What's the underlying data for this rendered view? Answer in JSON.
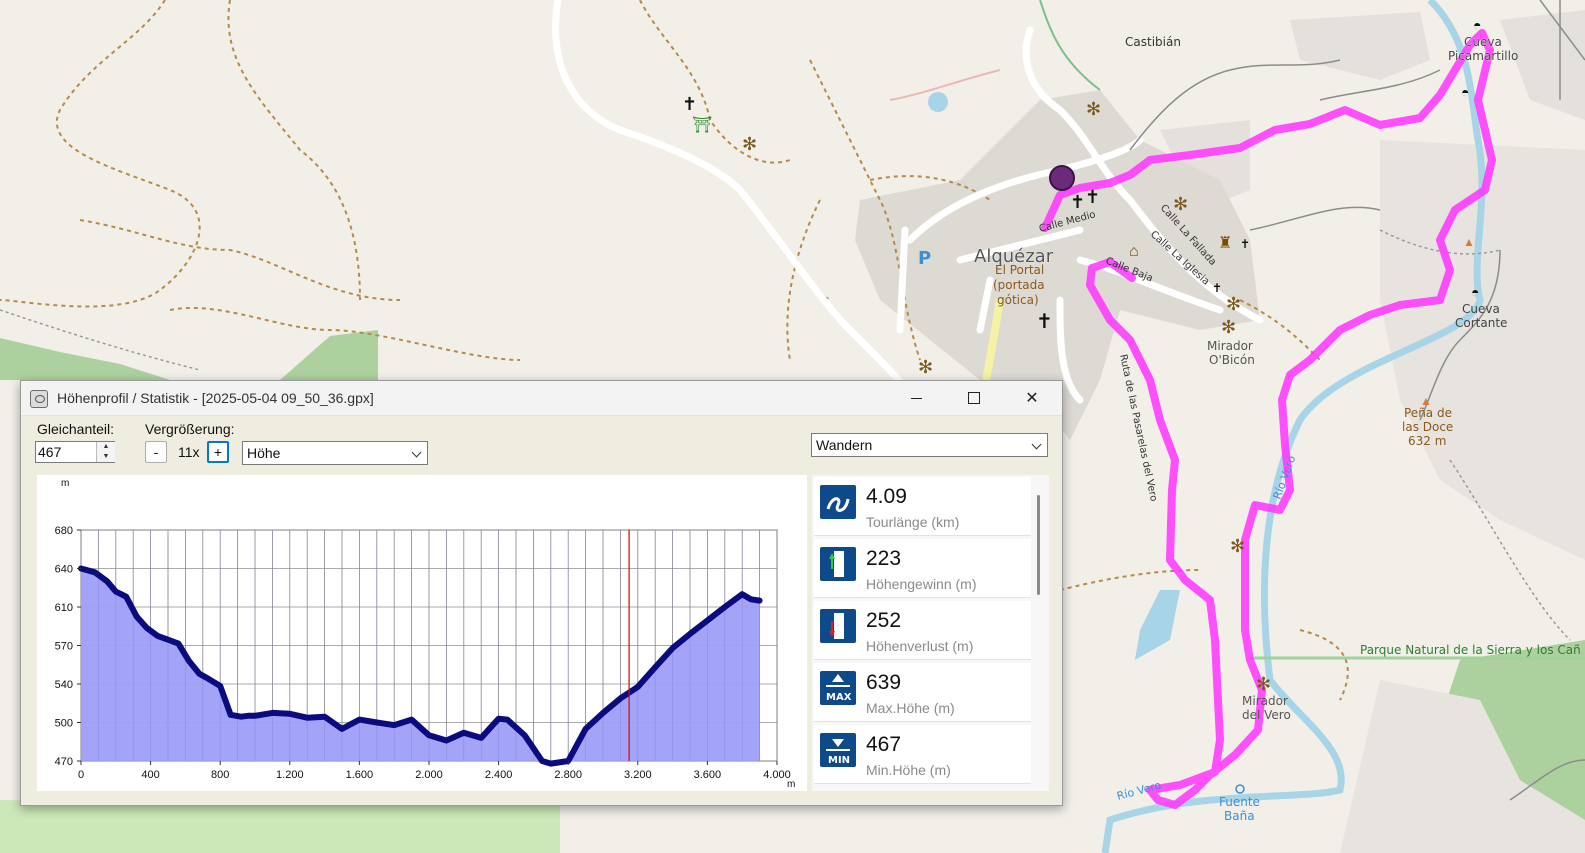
{
  "map": {
    "labels": {
      "castibian": "Castibián",
      "town": "Alquézar",
      "portal_1": "El Portal",
      "portal_2": "(portada",
      "portal_3": "gótica)",
      "parking": "P",
      "calle_medio": "Calle Medio",
      "calle_la_fallada": "Calle La Fallada",
      "calle_la_iglesia": "Calle La Iglesia",
      "calle_baja": "Calle Baja",
      "ruta_pasarelas": "Ruta de las Pasarelas del Vero",
      "mirador_obicon_1": "Mirador",
      "mirador_obicon_2": "O'Bicón",
      "cueva_picamartillo_1": "Cueva",
      "cueva_picamartillo_2": "Picamartillo",
      "cueva_cortante_1": "Cueva",
      "cueva_cortante_2": "Cortante",
      "pena_1": "Peña de",
      "pena_2": "las Doce",
      "pena_3": "632 m",
      "rio_vero_1": "Río Vero",
      "rio_vero_2": "Río Vero",
      "parque": "Parque Natural de la Sierra y los Cañ",
      "mirador_vero_1": "Mirador",
      "mirador_vero_2": "del Vero",
      "fuente_1": "Fuente",
      "fuente_2": "Baña"
    },
    "route_color": "#ff33ff"
  },
  "window": {
    "title": "Höhenprofil / Statistik - [2025-05-04 09_50_36.gpx]",
    "gleichanteil_label": "Gleichanteil:",
    "gleichanteil_value": "467",
    "zoom_label": "Vergrößerung:",
    "zoom_minus": "-",
    "zoom_value": "11x",
    "zoom_plus": "+",
    "profile_select": "Höhe",
    "activity_select": "Wandern"
  },
  "stats": [
    {
      "value": "4.09",
      "label": "Tourlänge (km)",
      "icon": "route-length-icon"
    },
    {
      "value": "223",
      "label": "Höhengewinn (m)",
      "icon": "elevation-gain-icon"
    },
    {
      "value": "252",
      "label": "Höhenverlust (m)",
      "icon": "elevation-loss-icon"
    },
    {
      "value": "639",
      "label": "Max.Höhe (m)",
      "icon": "max-elevation-icon"
    },
    {
      "value": "467",
      "label": "Min.Höhe (m)",
      "icon": "min-elevation-icon"
    }
  ],
  "chart_data": {
    "type": "area",
    "xlabel": "m",
    "ylabel": "m",
    "xlim": [
      0,
      4000
    ],
    "ylim": [
      470,
      680
    ],
    "xticks": [
      "0",
      "400",
      "800",
      "1.200",
      "1.600",
      "2.000",
      "2.400",
      "2.800",
      "3.200",
      "3.600",
      "4.000"
    ],
    "yticks": [
      "470",
      "500",
      "540",
      "570",
      "610",
      "640",
      "680"
    ],
    "grid": true,
    "marker_x": 3150,
    "line_color": "#0b0b80",
    "fill_color": "#9e9ef8",
    "x": [
      0,
      80,
      150,
      200,
      260,
      320,
      380,
      440,
      500,
      560,
      620,
      680,
      720,
      800,
      860,
      920,
      960,
      1000,
      1100,
      1200,
      1300,
      1400,
      1500,
      1600,
      1700,
      1800,
      1900,
      2000,
      2100,
      2200,
      2300,
      2400,
      2450,
      2550,
      2650,
      2700,
      2800,
      2900,
      3000,
      3100,
      3200,
      3300,
      3400,
      3500,
      3600,
      3700,
      3800,
      3850,
      3900
    ],
    "y": [
      640,
      637,
      630,
      622,
      618,
      600,
      588,
      580,
      576,
      572,
      558,
      548,
      545,
      538,
      508,
      506,
      507,
      507,
      510,
      509,
      505,
      506,
      495,
      503,
      500,
      498,
      503,
      490,
      486,
      492,
      488,
      504,
      503,
      490,
      470,
      468,
      470,
      495,
      510,
      525,
      537,
      553,
      568,
      582,
      596,
      610,
      620,
      616,
      615
    ]
  }
}
